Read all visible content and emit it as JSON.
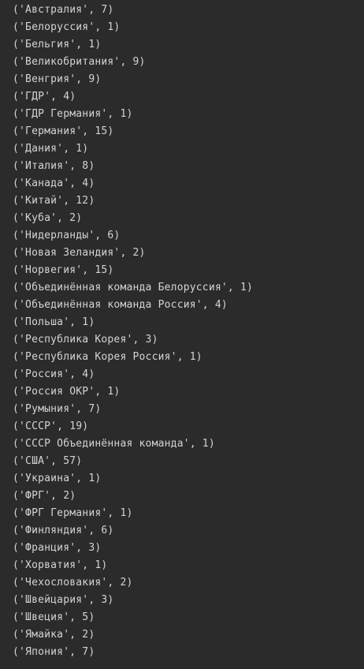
{
  "console": {
    "lines": [
      "('Австралия', 7)",
      "('Белоруссия', 1)",
      "('Бельгия', 1)",
      "('Великобритания', 9)",
      "('Венгрия', 9)",
      "('ГДР', 4)",
      "('ГДР Германия', 1)",
      "('Германия', 15)",
      "('Дания', 1)",
      "('Италия', 8)",
      "('Канада', 4)",
      "('Китай', 12)",
      "('Куба', 2)",
      "('Нидерланды', 6)",
      "('Новая Зеландия', 2)",
      "('Норвегия', 15)",
      "('Объединённая команда Белоруссия', 1)",
      "('Объединённая команда Россия', 4)",
      "('Польша', 1)",
      "('Республика Корея', 3)",
      "('Республика Корея Россия', 1)",
      "('Россия', 4)",
      "('Россия ОКР', 1)",
      "('Румыния', 7)",
      "('СССР', 19)",
      "('СССР Объединённая команда', 1)",
      "('США', 57)",
      "('Украина', 1)",
      "('ФРГ', 2)",
      "('ФРГ Германия', 1)",
      "('Финляндия', 6)",
      "('Франция', 3)",
      "('Хорватия', 1)",
      "('Чехословакия', 2)",
      "('Швейцария', 3)",
      "('Швеция', 5)",
      "('Ямайка', 2)",
      "('Япония', 7)"
    ]
  },
  "colors": {
    "background": "#2b2b2b",
    "text": "#d4d4d4"
  }
}
